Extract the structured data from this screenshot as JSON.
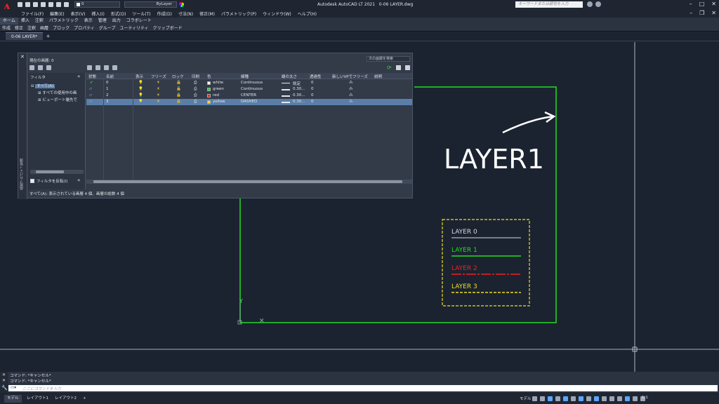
{
  "title_bar": {
    "app_title": "Autodesk AutoCAD LT 2021",
    "file_name": "0-06 LAYER.dwg",
    "current_layer": "0",
    "linetype_combo": "ByLayer",
    "search_placeholder": "キーワードまたは語句を入力"
  },
  "menu": [
    "ファイル(F)",
    "編集(E)",
    "表示(V)",
    "挿入(I)",
    "形式(O)",
    "ツール(T)",
    "作成(D)",
    "寸法(N)",
    "修正(M)",
    "パラメトリック(P)",
    "ウィンドウ(W)",
    "ヘルプ(H)"
  ],
  "ribbon_tabs": [
    "ホーム",
    "挿入",
    "注釈",
    "パラメトリック",
    "表示",
    "管理",
    "出力",
    "コラボレート"
  ],
  "ribbon_panels": [
    "作成",
    "修正",
    "注釈",
    "画層",
    "ブロック",
    "プロパティ",
    "グループ",
    "ユーティリティ",
    "クリップボード"
  ],
  "doc_tab": "0-06 LAYER*",
  "layer_panel": {
    "current_layer_label": "現在の画層: 0",
    "search_label": "次の画層を検索",
    "filter_header": "フィルタ",
    "tree": [
      "すべて(A)",
      "すべての使用中の画",
      "ビューポート優先で"
    ],
    "invert_filter": "フィルタを反転(I)",
    "vertical_title": "画層プロパティ管理",
    "columns": [
      "状態",
      "名前",
      "表示",
      "フリーズ",
      "ロック",
      "印刷",
      "色",
      "線種",
      "線の太さ",
      "透過性",
      "新しいVPでフリーズ",
      "説明"
    ],
    "rows": [
      {
        "name": "0",
        "color_name": "white",
        "color_hex": "#ffffff",
        "linetype": "Continuous",
        "lineweight": "既定",
        "transparency": "0",
        "current": true,
        "selected": false
      },
      {
        "name": "1",
        "color_name": "green",
        "color_hex": "#22dd22",
        "linetype": "Continuous",
        "lineweight": "0.30...",
        "transparency": "0",
        "current": false,
        "selected": false
      },
      {
        "name": "2",
        "color_name": "red",
        "color_hex": "#ee2222",
        "linetype": "CENTER",
        "lineweight": "0.30...",
        "transparency": "0",
        "current": false,
        "selected": false
      },
      {
        "name": "3",
        "color_name": "yellow",
        "color_hex": "#eedd22",
        "linetype": "DASHED",
        "lineweight": "0.30...",
        "transparency": "0",
        "current": false,
        "selected": true
      }
    ],
    "status_text": "すべて(A): 表示されている画層 4 個、画層の総数 4 個"
  },
  "drawing": {
    "annotation_text": "LAYER1",
    "legend": [
      {
        "label": "LAYER 0",
        "color": "#d8d8d8"
      },
      {
        "label": "LAYER 1",
        "color": "#22dd22"
      },
      {
        "label": "LAYER 2",
        "color": "#ee2222"
      },
      {
        "label": "LAYER 3",
        "color": "#eedd22"
      }
    ],
    "ucs_y": "Y"
  },
  "command": {
    "history": [
      "コマンド: *キャンセル*",
      "コマンド: *キャンセル*"
    ],
    "placeholder": "ここにコマンドを入力"
  },
  "status_bar": {
    "tabs": [
      "モデル",
      "レイアウト1",
      "レイアウト2"
    ],
    "add_tab": "+",
    "model_label": "モデル",
    "scale": "1:1"
  }
}
